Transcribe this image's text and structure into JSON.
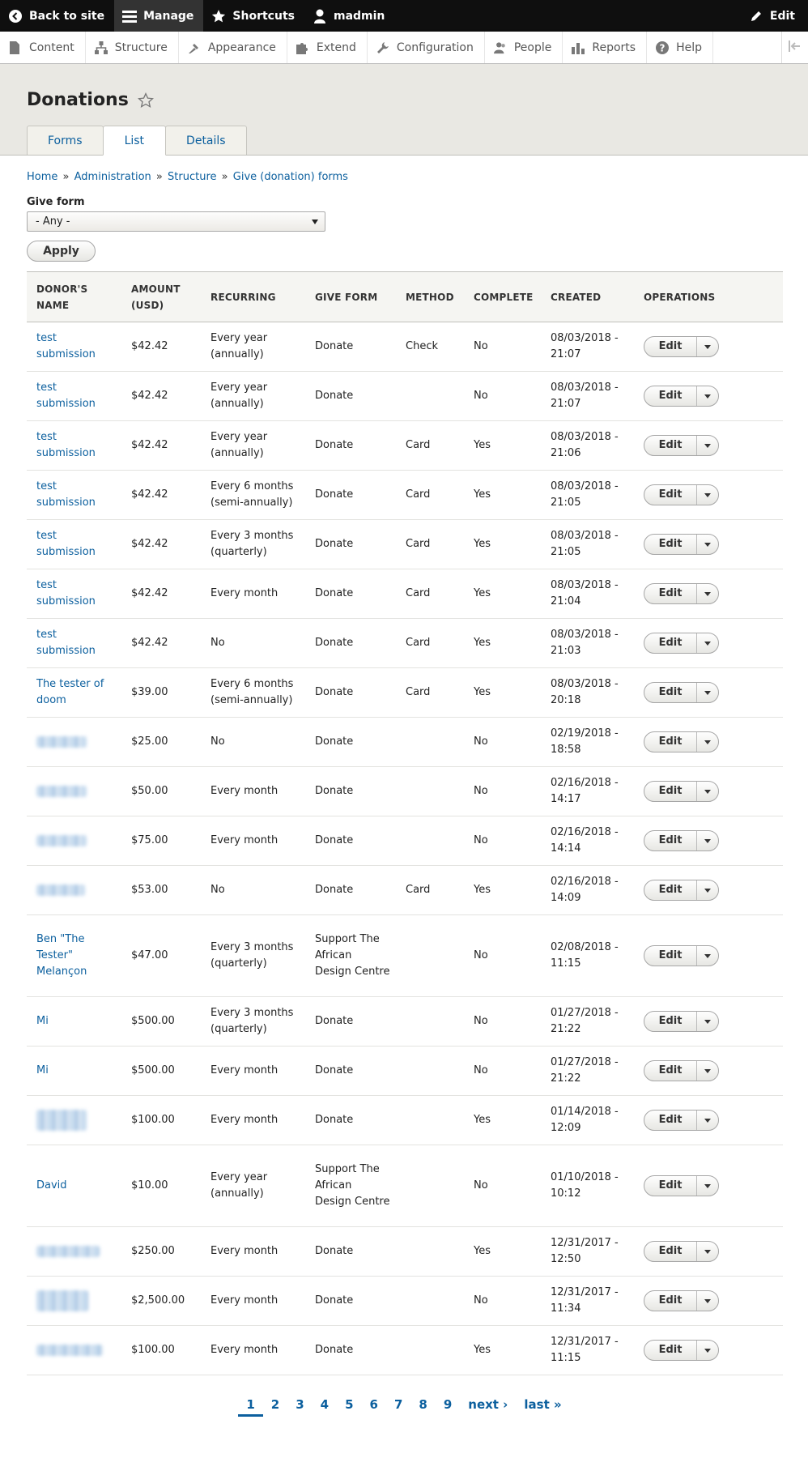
{
  "toolbar": {
    "back_to_site": "Back to site",
    "manage": "Manage",
    "shortcuts": "Shortcuts",
    "user": "madmin",
    "edit": "Edit"
  },
  "tray": {
    "items": [
      "Content",
      "Structure",
      "Appearance",
      "Extend",
      "Configuration",
      "People",
      "Reports",
      "Help"
    ]
  },
  "header": {
    "title": "Donations",
    "tabs": [
      "Forms",
      "List",
      "Details"
    ],
    "active_tab": "List"
  },
  "breadcrumb": [
    "Home",
    "Administration",
    "Structure",
    "Give (donation) forms"
  ],
  "breadcrumb_separator": "»",
  "filter": {
    "label": "Give form",
    "selected": "- Any -",
    "apply_label": "Apply"
  },
  "table": {
    "columns": [
      "DONOR'S NAME",
      "AMOUNT (USD)",
      "RECURRING",
      "GIVE FORM",
      "METHOD",
      "COMPLETE",
      "CREATED",
      "OPERATIONS"
    ],
    "edit_label": "Edit",
    "rows": [
      {
        "name": "test submission",
        "amount": "$42.42",
        "recurring": "Every year (annually)",
        "form": "Donate",
        "method": "Check",
        "complete": "No",
        "created": "08/03/2018 - 21:07"
      },
      {
        "name": "test submission",
        "amount": "$42.42",
        "recurring": "Every year (annually)",
        "form": "Donate",
        "method": "",
        "complete": "No",
        "created": "08/03/2018 - 21:07"
      },
      {
        "name": "test submission",
        "amount": "$42.42",
        "recurring": "Every year (annually)",
        "form": "Donate",
        "method": "Card",
        "complete": "Yes",
        "created": "08/03/2018 - 21:06"
      },
      {
        "name": "test submission",
        "amount": "$42.42",
        "recurring": "Every 6 months (semi-annually)",
        "form": "Donate",
        "method": "Card",
        "complete": "Yes",
        "created": "08/03/2018 - 21:05"
      },
      {
        "name": "test submission",
        "amount": "$42.42",
        "recurring": "Every 3 months (quarterly)",
        "form": "Donate",
        "method": "Card",
        "complete": "Yes",
        "created": "08/03/2018 - 21:05"
      },
      {
        "name": "test submission",
        "amount": "$42.42",
        "recurring": "Every month",
        "form": "Donate",
        "method": "Card",
        "complete": "Yes",
        "created": "08/03/2018 - 21:04"
      },
      {
        "name": "test submission",
        "amount": "$42.42",
        "recurring": "No",
        "form": "Donate",
        "method": "Card",
        "complete": "Yes",
        "created": "08/03/2018 - 21:03"
      },
      {
        "name": "The tester of doom",
        "amount": "$39.00",
        "recurring": "Every 6 months (semi-annually)",
        "form": "Donate",
        "method": "Card",
        "complete": "Yes",
        "created": "08/03/2018 - 20:18"
      },
      {
        "name": "",
        "amount": "$25.00",
        "recurring": "No",
        "form": "Donate",
        "method": "",
        "complete": "No",
        "created": "02/19/2018 - 18:58"
      },
      {
        "name": "",
        "amount": "$50.00",
        "recurring": "Every month",
        "form": "Donate",
        "method": "",
        "complete": "No",
        "created": "02/16/2018 - 14:17"
      },
      {
        "name": "",
        "amount": "$75.00",
        "recurring": "Every month",
        "form": "Donate",
        "method": "",
        "complete": "No",
        "created": "02/16/2018 - 14:14"
      },
      {
        "name": "",
        "amount": "$53.00",
        "recurring": "No",
        "form": "Donate",
        "method": "Card",
        "complete": "Yes",
        "created": "02/16/2018 - 14:09"
      },
      {
        "name": "Ben \"The Tester\" Melançon",
        "amount": "$47.00",
        "recurring": "Every 3 months (quarterly)",
        "form": "Support The African Design Centre",
        "method": "",
        "complete": "No",
        "created": "02/08/2018 - 11:15"
      },
      {
        "name": "Mi",
        "amount": "$500.00",
        "recurring": "Every 3 months (quarterly)",
        "form": "Donate",
        "method": "",
        "complete": "No",
        "created": "01/27/2018 - 21:22"
      },
      {
        "name": "Mi",
        "amount": "$500.00",
        "recurring": "Every month",
        "form": "Donate",
        "method": "",
        "complete": "No",
        "created": "01/27/2018 - 21:22"
      },
      {
        "name": "",
        "amount": "$100.00",
        "recurring": "Every month",
        "form": "Donate",
        "method": "",
        "complete": "Yes",
        "created": "01/14/2018 - 12:09"
      },
      {
        "name": "David",
        "amount": "$10.00",
        "recurring": "Every year (annually)",
        "form": "Support The African Design Centre",
        "method": "",
        "complete": "No",
        "created": "01/10/2018 - 10:12"
      },
      {
        "name": "",
        "amount": "$250.00",
        "recurring": "Every month",
        "form": "Donate",
        "method": "",
        "complete": "Yes",
        "created": "12/31/2017 - 12:50"
      },
      {
        "name": "",
        "amount": "$2,500.00",
        "recurring": "Every month",
        "form": "Donate",
        "method": "",
        "complete": "No",
        "created": "12/31/2017 - 11:34"
      },
      {
        "name": "",
        "amount": "$100.00",
        "recurring": "Every month",
        "form": "Donate",
        "method": "",
        "complete": "Yes",
        "created": "12/31/2017 - 11:15"
      }
    ]
  },
  "pager": {
    "pages": [
      "1",
      "2",
      "3",
      "4",
      "5",
      "6",
      "7",
      "8",
      "9"
    ],
    "current": "1",
    "next": "next ›",
    "last": "last »"
  },
  "colors": {
    "link": "#0b5f9e",
    "toolbar_bg": "#0f0f0f",
    "header_bg": "#e9e8e3"
  }
}
